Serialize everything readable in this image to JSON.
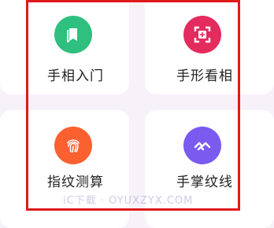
{
  "grid": {
    "items": [
      {
        "label": "手相入门",
        "icon": "book-icon",
        "color": "#2fbf7e"
      },
      {
        "label": "手形看相",
        "icon": "palm-frame-icon",
        "color": "#e32b5e"
      },
      {
        "label": "指纹测算",
        "icon": "fingerprint-icon",
        "color": "#fb6030"
      },
      {
        "label": "手掌纹线",
        "icon": "palm-lines-icon",
        "color": "#7b5af0"
      }
    ]
  },
  "highlight": {
    "color": "#e01919"
  },
  "watermark": {
    "text": "iC下载 · OYUXZYX.COM"
  }
}
